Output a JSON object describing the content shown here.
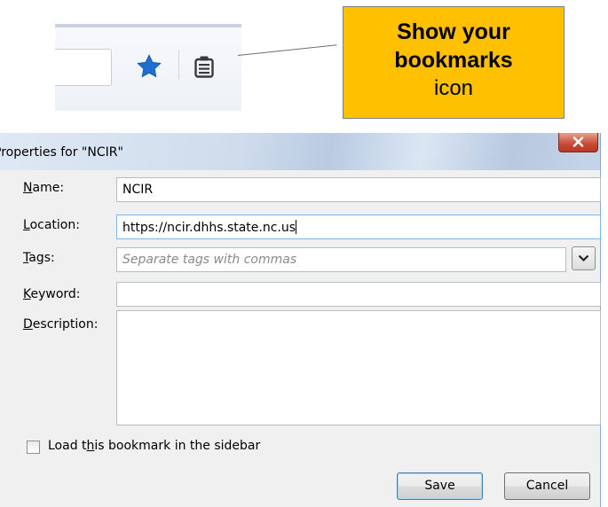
{
  "callout": {
    "line1": "Show your",
    "line2": "bookmarks",
    "line3": "icon"
  },
  "toolbar": {
    "icons": [
      "star-icon",
      "show-bookmarks-icon"
    ],
    "star_color": "#1f6fd1"
  },
  "dialog": {
    "title": "Properties for \"NCIR\"",
    "name": {
      "label_key": "N",
      "label_rest": "ame:",
      "value": "NCIR"
    },
    "location": {
      "label_key": "L",
      "label_rest": "ocation:",
      "value": "https://ncir.dhhs.state.nc.us"
    },
    "tags": {
      "label_key": "T",
      "label_rest": "ags:",
      "placeholder": "Separate tags with commas"
    },
    "keyword": {
      "label_key": "K",
      "label_rest": "eyword:",
      "value": ""
    },
    "description": {
      "label_key": "D",
      "label_rest": "escription:",
      "value": ""
    },
    "sidebar_checkbox": {
      "label_pre": "Load t",
      "label_key": "h",
      "label_post": "is bookmark in the sidebar",
      "checked": false
    },
    "save_label": "Save",
    "cancel_label": "Cancel"
  }
}
